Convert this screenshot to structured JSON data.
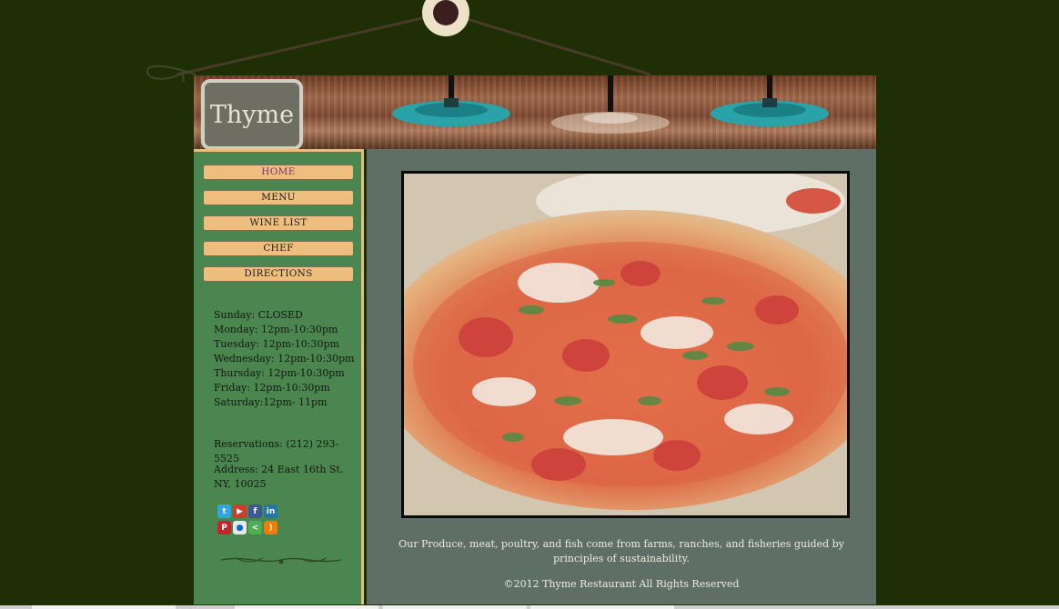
{
  "brand": {
    "logo_text": "Thyme"
  },
  "nav": {
    "items": [
      {
        "label": "HOME",
        "active": true
      },
      {
        "label": "MENU",
        "active": false
      },
      {
        "label": "WINE LIST",
        "active": false
      },
      {
        "label": "CHEF",
        "active": false
      },
      {
        "label": "DIRECTIONS",
        "active": false
      }
    ]
  },
  "hours": [
    "Sunday: CLOSED",
    "Monday: 12pm-10:30pm",
    "Tuesday: 12pm-10:30pm",
    "Wednesday: 12pm-10:30pm",
    "Thursday: 12pm-10:30pm",
    "Friday: 12pm-10:30pm",
    "Saturday:12pm- 11pm"
  ],
  "contact": {
    "reservations": "Reservations: (212) 293-5525",
    "address": "Address: 24 East 16th St. NY, 10025"
  },
  "social": {
    "icons": [
      "twitter-icon",
      "youtube-icon",
      "facebook-icon",
      "linkedin-icon",
      "pinterest-icon",
      "flickr-icon",
      "share-icon",
      "rss-icon"
    ]
  },
  "main": {
    "tagline": "Our Produce, meat, poultry, and fish come from farms, ranches, and fisheries guided by principles of sustainability.",
    "copyright": "©2012 Thyme Restaurant All Rights Reserved"
  },
  "colors": {
    "background": "#1f2f05",
    "sidebar": "#4b8650",
    "nav_button": "#eebf7c",
    "content": "#5f6f66",
    "active_nav_text": "#7b2b7a"
  }
}
